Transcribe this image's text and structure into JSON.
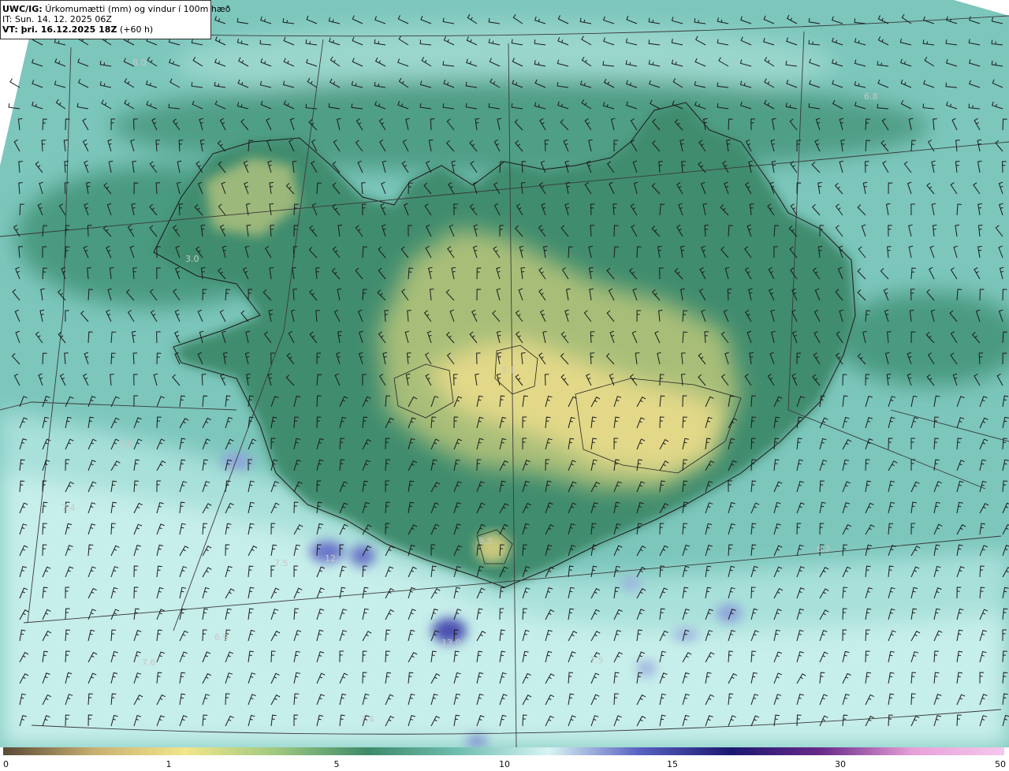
{
  "header": {
    "code": "UWC/IG:",
    "title": "Úrkomumætti (mm) og vindur í 100m hæð",
    "init_time": "IT: Sun. 14. 12. 2025 06Z",
    "valid_label": "VT: þri. 16.12.2025 18Z",
    "lead": "(+60 h)"
  },
  "value_labels": [
    "8.0",
    "6.8",
    "3.0",
    "5.8",
    "7.4",
    "6.2",
    "7.5",
    "12.",
    "7.6",
    "6.9",
    "13.0",
    "7.5",
    "7.4",
    "5.1",
    "8.3"
  ],
  "colorbar": {
    "ticks": [
      "0",
      "1",
      "5",
      "10",
      "15",
      "30",
      "50"
    ],
    "colors": [
      "#5a4a36",
      "#c8b070",
      "#f2e68a",
      "#9ec880",
      "#3e8a6a",
      "#6fbeb0",
      "#d8f4f4",
      "#5860c0",
      "#1c1870",
      "#6a2a8a",
      "#e8a0d8",
      "#f4c8ec"
    ]
  },
  "map_colors": {
    "ocean": "#7cc6bc",
    "ocean_light": "#b6e6e2",
    "land_dark": "#3e8a6e",
    "land_mid": "#8cb67a",
    "land_light": "#e6dc8a",
    "heavy": "#5a60b8"
  }
}
